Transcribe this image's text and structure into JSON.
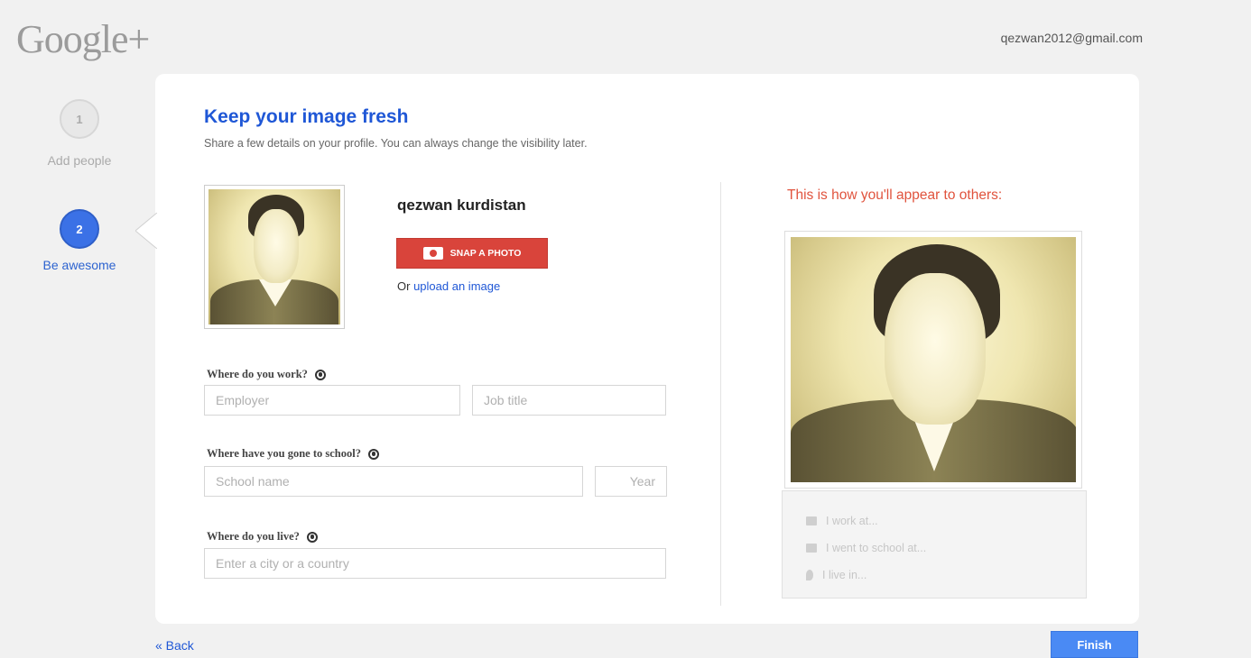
{
  "header": {
    "logo": "Google+",
    "account_email": "qezwan2012@gmail.com"
  },
  "steps": [
    {
      "number": "1",
      "label": "Add people",
      "active": false
    },
    {
      "number": "2",
      "label": "Be awesome",
      "active": true
    }
  ],
  "main": {
    "title": "Keep your image fresh",
    "subtitle": "Share a few details on your profile. You can always change the visibility later.",
    "profile_name": "qezwan kurdistan",
    "snap_button": "SNAP A PHOTO",
    "upload_prefix": "Or",
    "upload_link": "upload an image",
    "work": {
      "label": "Where do you work?",
      "employer_placeholder": "Employer",
      "jobtitle_placeholder": "Job title"
    },
    "school": {
      "label": "Where have you gone to school?",
      "school_placeholder": "School name",
      "year_placeholder": "Year"
    },
    "live": {
      "label": "Where do you live?",
      "city_placeholder": "Enter a city or a country"
    }
  },
  "preview": {
    "heading": "This is how you'll appear to others:",
    "rows": [
      "I work at...",
      "I went to school at...",
      "I live in..."
    ]
  },
  "footer": {
    "back": "« Back",
    "finish": "Finish"
  },
  "colors": {
    "accent_blue": "#1f57d6",
    "snap_red": "#d9443b",
    "finish_blue": "#4a8af4",
    "appear_red": "#e0533d"
  }
}
